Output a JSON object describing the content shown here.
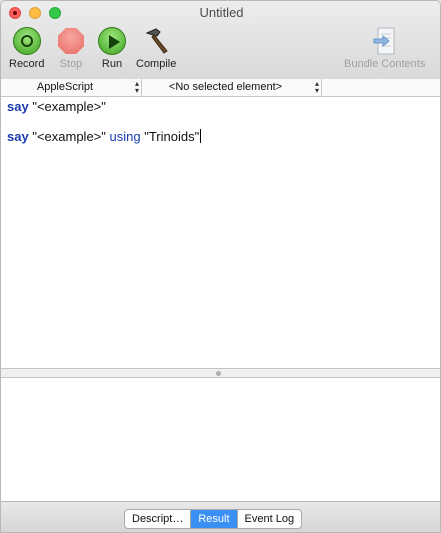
{
  "window": {
    "title": "Untitled"
  },
  "toolbar": {
    "record_label": "Record",
    "stop_label": "Stop",
    "run_label": "Run",
    "compile_label": "Compile",
    "bundle_label": "Bundle Contents"
  },
  "navbar": {
    "language": "AppleScript",
    "element": "<No selected element>"
  },
  "editor": {
    "lines": [
      {
        "keyword": "say",
        "string": "\"<example>\"",
        "keyword2": "",
        "string2": ""
      },
      {
        "keyword": "say",
        "string": "\"<example>\"",
        "keyword2": "using",
        "string2": "\"Trinoids\""
      }
    ]
  },
  "bottom_tabs": {
    "description_label": "Descript…",
    "result_label": "Result",
    "event_log_label": "Event Log",
    "selected": "Result"
  },
  "colors": {
    "keyword": "#1a3bb3",
    "selected_tab": "#3a8ff3"
  }
}
